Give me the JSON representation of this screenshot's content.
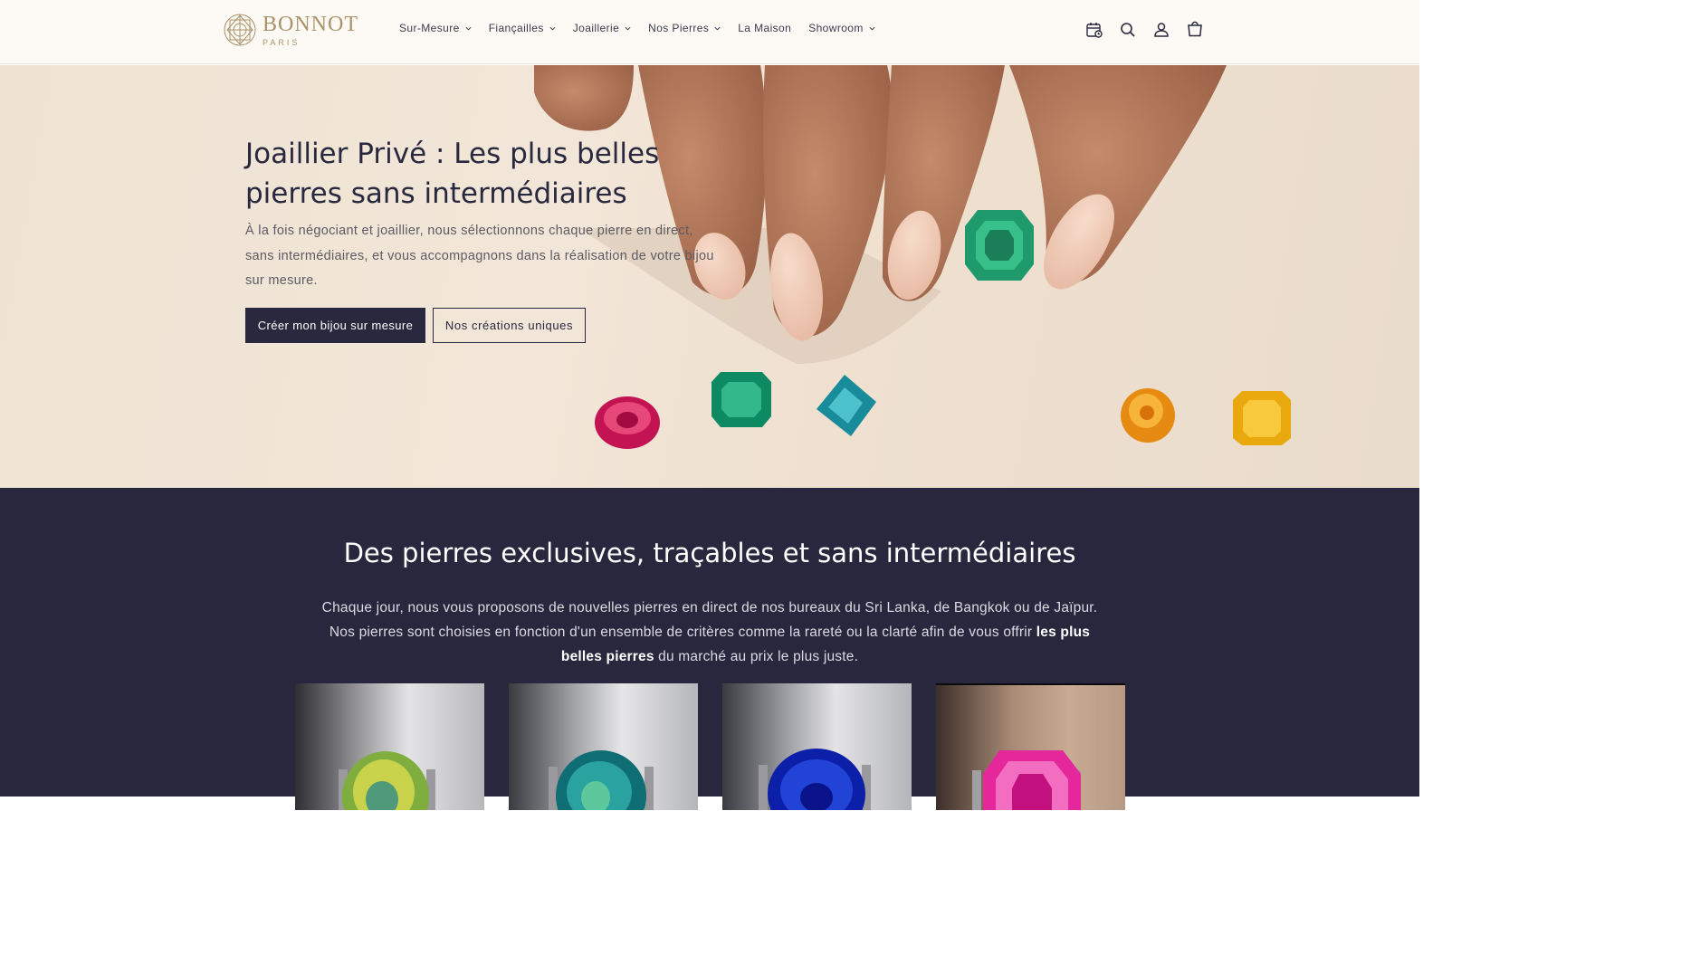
{
  "header": {
    "logo_main": "BONNOT",
    "logo_sub": "PARIS",
    "nav": [
      {
        "label": "Sur-Mesure",
        "dropdown": true
      },
      {
        "label": "Fiançailles",
        "dropdown": true
      },
      {
        "label": "Joaillerie",
        "dropdown": true
      },
      {
        "label": "Nos Pierres",
        "dropdown": true
      },
      {
        "label": "La Maison",
        "dropdown": false
      },
      {
        "label": "Showroom",
        "dropdown": true
      }
    ],
    "icons": [
      "calendar-icon",
      "search-icon",
      "account-icon",
      "cart-icon"
    ]
  },
  "hero": {
    "title": "Joaillier Privé : Les plus belles pierres sans intermédiaires",
    "subtitle": "À la fois négociant et joaillier, nous sélectionnons chaque pierre en direct, sans intermédiaires, et vous accompagnons dans la réalisation de votre bijou sur mesure.",
    "primary_button": "Créer mon bijou sur mesure",
    "secondary_button": "Nos créations uniques"
  },
  "section": {
    "title": "Des pierres exclusives, traçables et sans intermédiaires",
    "text_before": "Chaque jour, nous vous proposons de nouvelles pierres en direct de nos bureaux du Sri Lanka, de Bangkok ou de Jaïpur. Nos pierres sont choisies en fonction d'un ensemble de critères comme la rareté ou la clarté afin de vous offrir ",
    "text_bold": "les plus belles pierres",
    "text_after": " du marché au prix le plus juste.",
    "cards": [
      {
        "stone": "yellow-green sapphire"
      },
      {
        "stone": "teal sapphire"
      },
      {
        "stone": "blue sapphire"
      },
      {
        "stone": "pink sapphire"
      }
    ]
  },
  "colors": {
    "brand_gold": "#a9936a",
    "navy": "#28283f",
    "section_bg": "#28273e",
    "header_bg": "#fdf9f4"
  }
}
